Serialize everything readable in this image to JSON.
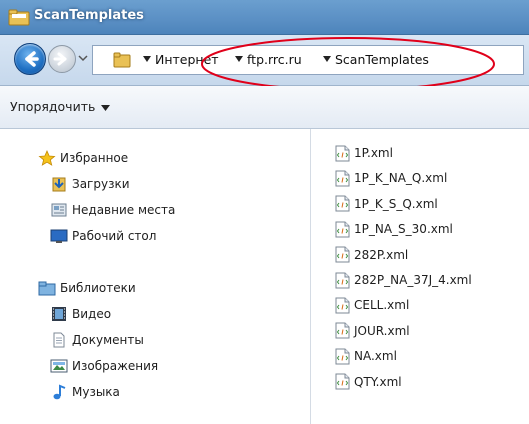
{
  "window": {
    "title": "ScanTemplates"
  },
  "address_bar": {
    "crumbs": [
      "Интернет",
      "ftp.rrc.ru",
      "ScanTemplates"
    ],
    "annotation_color": "#e0001a"
  },
  "toolbar": {
    "organize_label": "Упорядочить"
  },
  "nav_pane": {
    "favorites": {
      "label": "Избранное",
      "items": [
        {
          "label": "Загрузки",
          "icon": "downloads-icon"
        },
        {
          "label": "Недавние места",
          "icon": "recent-places-icon"
        },
        {
          "label": "Рабочий стол",
          "icon": "desktop-icon"
        }
      ]
    },
    "libraries": {
      "label": "Библиотеки",
      "items": [
        {
          "label": "Видео",
          "icon": "video-icon"
        },
        {
          "label": "Документы",
          "icon": "documents-icon"
        },
        {
          "label": "Изображения",
          "icon": "pictures-icon"
        },
        {
          "label": "Музыка",
          "icon": "music-icon"
        }
      ]
    }
  },
  "files": [
    "1P.xml",
    "1P_K_NA_Q.xml",
    "1P_K_S_Q.xml",
    "1P_NA_S_30.xml",
    "282P.xml",
    "282P_NA_37J_4.xml",
    "CELL.xml",
    "JOUR.xml",
    "NA.xml",
    "QTY.xml"
  ],
  "colors": {
    "title_bar": "#5a8fc4",
    "nav_bar": "#cfdeef",
    "annotation": "#e0001a"
  }
}
